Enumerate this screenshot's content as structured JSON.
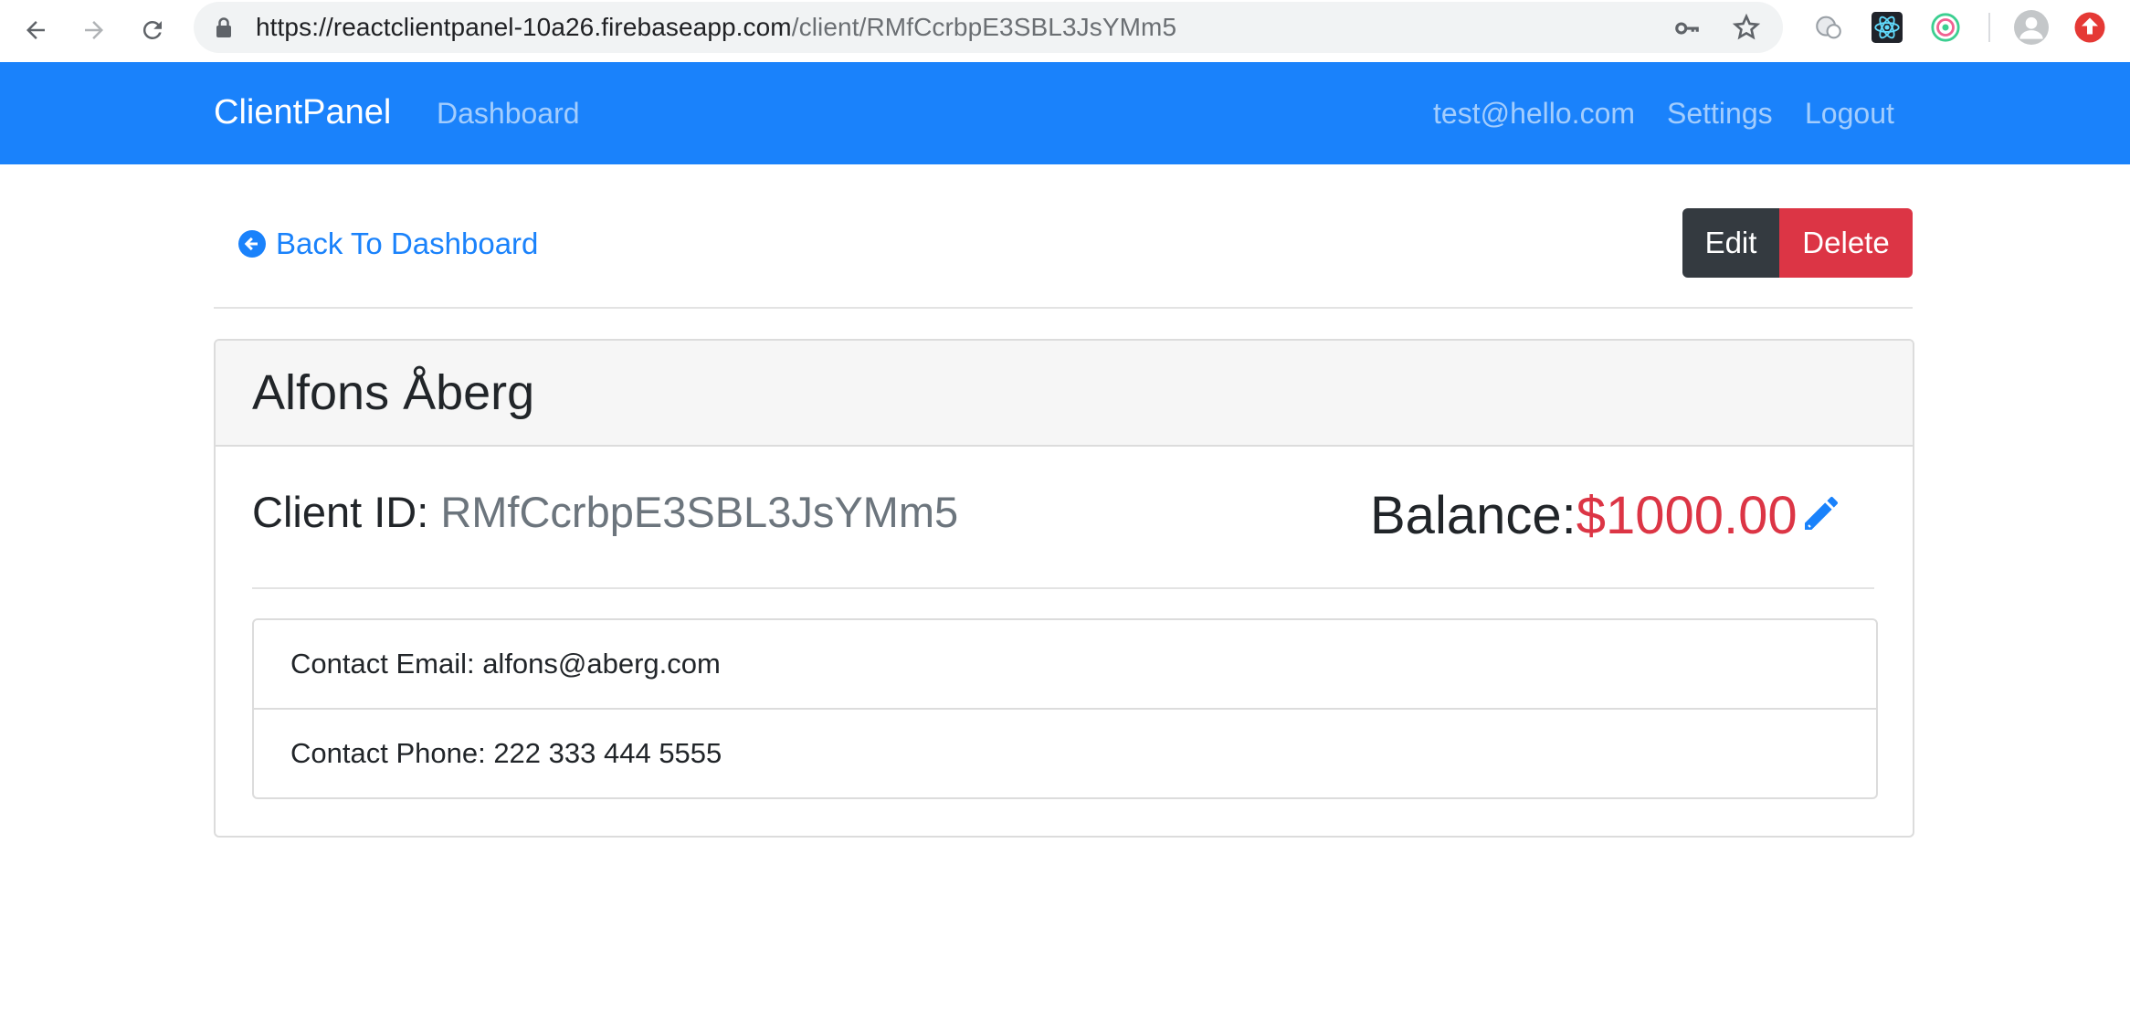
{
  "browser": {
    "url_host": "https://reactclientpanel-10a26.firebaseapp.com",
    "url_path": "/client/RMfCcrbpE3SBL3JsYMm5"
  },
  "navbar": {
    "brand": "ClientPanel",
    "dashboard": "Dashboard",
    "user_email": "test@hello.com",
    "settings": "Settings",
    "logout": "Logout",
    "color": "#1a82fb"
  },
  "actions": {
    "back_label": "Back To Dashboard",
    "edit_label": "Edit",
    "delete_label": "Delete"
  },
  "client": {
    "name": "Alfons Åberg",
    "id_label": "Client ID:",
    "id_value": "RMfCcrbpE3SBL3JsYMm5",
    "balance_label": "Balance:",
    "balance_value": "$1000.00",
    "email_text": "Contact Email: alfons@aberg.com",
    "phone_text": "Contact Phone: 222 333 444 5555"
  },
  "icons": {
    "back": "arrow-circle-left-icon",
    "edit_balance": "pencil-icon"
  },
  "colors": {
    "primary": "#1a82fb",
    "danger": "#dc3545",
    "dark": "#343a40",
    "muted": "#6c757d"
  }
}
